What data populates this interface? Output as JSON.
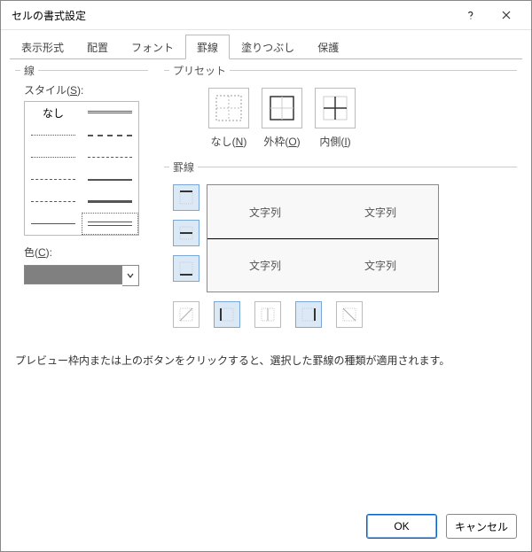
{
  "window": {
    "title": "セルの書式設定"
  },
  "tabs": {
    "items": [
      {
        "label": "表示形式"
      },
      {
        "label": "配置"
      },
      {
        "label": "フォント"
      },
      {
        "label": "罫線"
      },
      {
        "label": "塗りつぶし"
      },
      {
        "label": "保護"
      }
    ],
    "active_index": 3
  },
  "line_group": {
    "legend": "線",
    "style_label_pre": "スタイル(",
    "style_key": "S",
    "style_label_post": "):",
    "none_label": "なし",
    "color_label_pre": "色(",
    "color_key": "C",
    "color_label_post": "):",
    "color_value": "#808080"
  },
  "preset_group": {
    "legend": "プリセット",
    "items": [
      {
        "label_pre": "なし(",
        "key": "N",
        "label_post": ")"
      },
      {
        "label_pre": "外枠(",
        "key": "O",
        "label_post": ")"
      },
      {
        "label_pre": "内側(",
        "key": "I",
        "label_post": ")"
      }
    ]
  },
  "border_group": {
    "legend": "罫線",
    "sample_text": "文字列"
  },
  "hint": "プレビュー枠内または上のボタンをクリックすると、選択した罫線の種類が適用されます。",
  "footer": {
    "ok": "OK",
    "cancel": "キャンセル"
  }
}
